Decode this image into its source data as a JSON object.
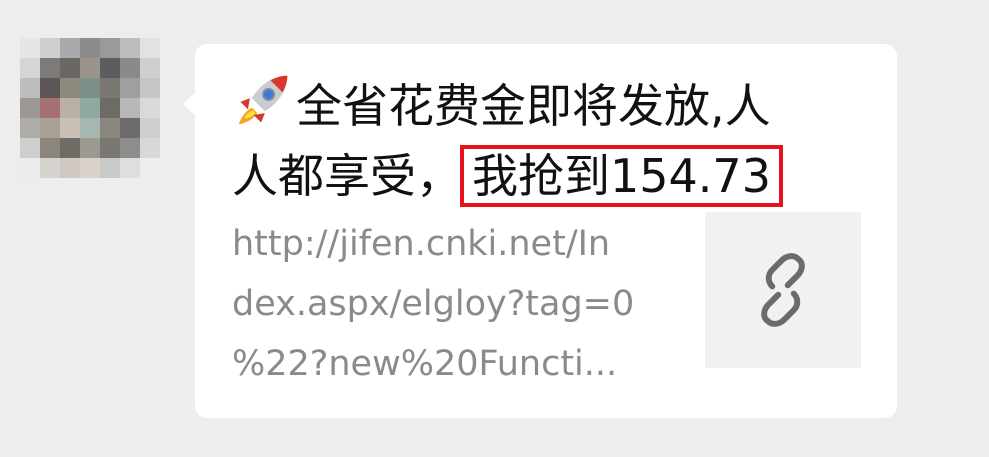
{
  "message": {
    "title_line1": "全省花费金即将发放,人",
    "title_line2_prefix": "人都享受，",
    "title_highlight": "我抢到154.73",
    "url_line1": "http://jifen.cnki.net/In",
    "url_line2": "dex.aspx/elgloy?tag=0",
    "url_line3": "%22?new%20Functi...",
    "title_icon": "rocket-icon",
    "thumbnail_icon": "link-icon"
  },
  "colors": {
    "background": "#ededed",
    "bubble": "#ffffff",
    "highlight_border": "#e5131c",
    "url_text": "#8a8a8a",
    "thumbnail_bg": "#f1f1f1"
  }
}
